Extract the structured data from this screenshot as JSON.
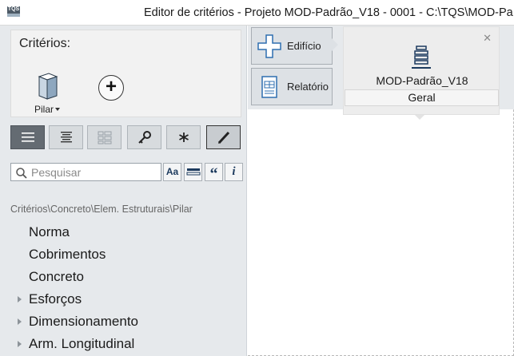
{
  "window": {
    "logo_text": "TQS",
    "title": "Editor de critérios - Projeto MOD-Padrão_V18 - 0001 - C:\\TQS\\MOD-Pa"
  },
  "criterios_panel": {
    "title": "Critérios:",
    "pilar_label": "Pilar"
  },
  "toolbar": {
    "icons": [
      "list-view-icon",
      "align-center-icon",
      "grid-view-icon",
      "key-icon",
      "asterisk-icon",
      "pencil-icon"
    ]
  },
  "search": {
    "placeholder": "Pesquisar",
    "match_case_label": "Aa",
    "quote_label": "“"
  },
  "tree": {
    "path": "Critérios\\Concreto\\Elem. Estruturais\\Pilar",
    "items": [
      {
        "label": "Norma",
        "expandable": false
      },
      {
        "label": "Cobrimentos",
        "expandable": false
      },
      {
        "label": "Concreto",
        "expandable": false
      },
      {
        "label": "Esforços",
        "expandable": true
      },
      {
        "label": "Dimensionamento",
        "expandable": true
      },
      {
        "label": "Arm. Longitudinal",
        "expandable": true
      }
    ]
  },
  "nav": {
    "edificio_label": "Edifício",
    "relatorio_label": "Relatório"
  },
  "popup": {
    "close_label": "✕",
    "title": "MOD-Padrão_V18",
    "footer": "Geral"
  },
  "colors": {
    "panel_bg": "#e6e9ec",
    "active_button": "#646b72",
    "accent_blue": "#2f6fb0"
  }
}
